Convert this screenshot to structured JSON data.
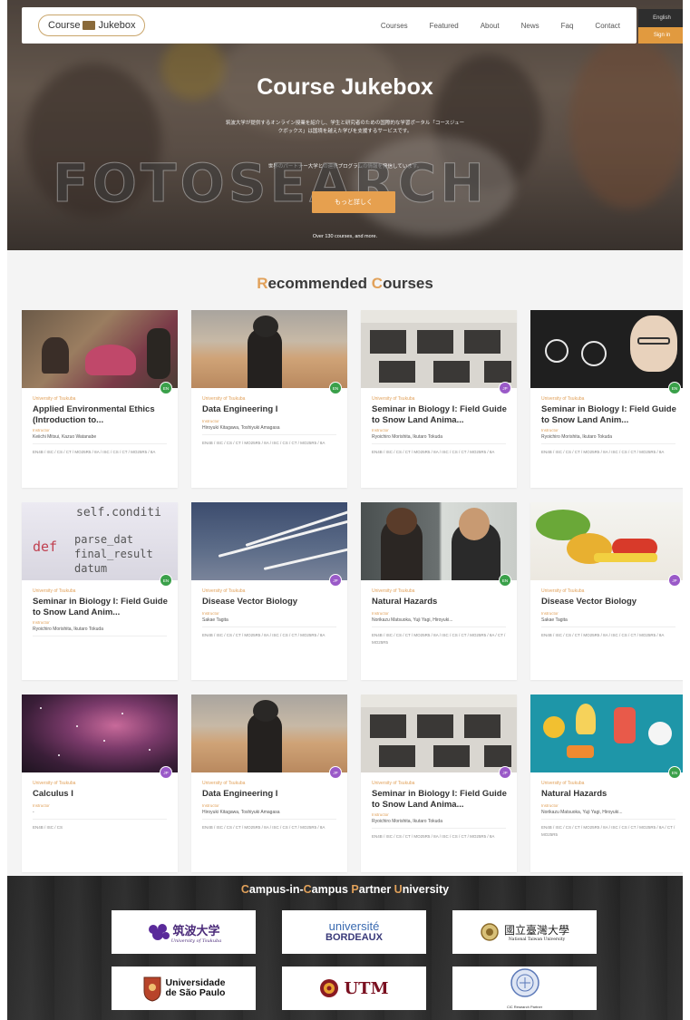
{
  "nav": {
    "logo_left": "Course",
    "logo_right": "Jukebox",
    "links": [
      "Courses",
      "Featured",
      "About",
      "News",
      "Faq",
      "Contact"
    ],
    "lang": "English",
    "signin": "Sign in"
  },
  "hero": {
    "title": "Course Jukebox",
    "desc1": "筑波大学が提供するオンライン授業を紹介し、学生と研究者のための国際的な学習ポータル「コースジュークボックス」は国境を越えた学びを支援するサービスです。",
    "desc2": "世界のパートナー大学との連携プログラムの情報を発信しています。",
    "cta": "もっと詳しく",
    "count": "Over 130 courses, and more."
  },
  "watermark": "FOTOSEARCH",
  "recommended": {
    "title_a1": "R",
    "title_a2": "ecommended ",
    "title_b1": "C",
    "title_b2": "ourses"
  },
  "courses": [
    {
      "univ": "University of Tsukuba",
      "title": "Applied Environmental Ethics (Introduction to...",
      "instr_label": "Instructor",
      "instr": "Keiichi Mitsui, Kazuo Watanabe",
      "tags": "EN4B / ISC / CS / CT / MO25R5 / 8A / ISC / CS / CT / MO25R5 / 8A",
      "badge": "EN"
    },
    {
      "univ": "University of Tsukuba",
      "title": "Data Engineering I",
      "instr_label": "Instructor",
      "instr": "Hiroyuki Kitagawa, Toshiyuki Amagasa",
      "tags": "EN4B / ISC / CS / CT / MO25R5 / 8A / ISC / CS / CT / MO25R5 / 8A",
      "badge": "EN"
    },
    {
      "univ": "University of Tsukuba",
      "title": "Seminar in Biology I: Field Guide to Snow Land Anima...",
      "instr_label": "Instructor",
      "instr": "Ryoichiro Morishita, Ikutaro Tokuda",
      "tags": "EN4B / ISC / CS / CT / MO25R5 / 8A / ISC / CS / CT / MO25R5 / 8A",
      "badge": "JP"
    },
    {
      "univ": "University of Tsukuba",
      "title": "Seminar in Biology I: Field Guide to Snow Land Anim...",
      "instr_label": "Instructor",
      "instr": "Ryoichiro Morishita, Ikutaro Tokuda",
      "tags": "EN4B / ISC / CS / CT / MO25R5 / 8A / ISC / CS / CT / MO25R5 / 8A",
      "badge": "EN"
    },
    {
      "univ": "University of Tsukuba",
      "title": "Seminar in Biology I: Field Guide to Snow Land Anim...",
      "instr_label": "Instructor",
      "instr": "Ryoichiro Morishita, Ikutaro Tokuda",
      "tags": "",
      "badge": "EN"
    },
    {
      "univ": "University of Tsukuba",
      "title": "Disease Vector Biology",
      "instr_label": "Instructor",
      "instr": "Sakae Tagita",
      "tags": "EN4B / ISC / CS / CT / MO25R5 / 8A / ISC / CS / CT / MO25R5 / 8A",
      "badge": "JP"
    },
    {
      "univ": "University of Tsukuba",
      "title": "Natural Hazards",
      "instr_label": "Instructor",
      "instr": "Norikazu Matsuoka, Yuji Yagi, Hiroyuki...",
      "tags": "EN4B / ISC / CS / CT / MO25R5 / 8A / ISC / CS / CT / MO25R5 / 8A / CT / MO25R5",
      "badge": "EN"
    },
    {
      "univ": "University of Tsukuba",
      "title": "Disease Vector Biology",
      "instr_label": "Instructor",
      "instr": "Sakae Tagita",
      "tags": "EN4B / ISC / CS / CT / MO25R5 / 8A / ISC / CS / CT / MO25R5 / 8A",
      "badge": "JP"
    },
    {
      "univ": "University of Tsukuba",
      "title": "Calculus I",
      "instr_label": "Instructor",
      "instr": "-",
      "tags": "EN4B / ISC / CS",
      "badge": "JP"
    },
    {
      "univ": "University of Tsukuba",
      "title": "Data Engineering I",
      "instr_label": "Instructor",
      "instr": "Hiroyuki Kitagawa, Toshiyuki Amagasa",
      "tags": "EN4B / ISC / CS / CT / MO25R5 / 8A / ISC / CS / CT / MO25R5 / 8A",
      "badge": "JP"
    },
    {
      "univ": "University of Tsukuba",
      "title": "Seminar in Biology I: Field Guide to Snow Land Anima...",
      "instr_label": "Instructor",
      "instr": "Ryoichiro Morishita, Ikutaro Tokuda",
      "tags": "EN4B / ISC / CS / CT / MO25R5 / 8A / ISC / CS / CT / MO25R5 / 8A",
      "badge": "JP"
    },
    {
      "univ": "University of Tsukuba",
      "title": "Natural Hazards",
      "instr_label": "Instructor",
      "instr": "Norikazu Matsuoka, Yuji Yagi, Hiroyuki...",
      "tags": "EN4B / ISC / CS / CT / MO25R5 / 8A / ISC / CS / CT / MO25R5 / 8A / CT / MO25R5",
      "badge": "EN"
    }
  ],
  "partners": {
    "title_parts": [
      "C",
      "ampus-in-",
      "C",
      "ampus ",
      "P",
      "artner ",
      "U",
      "niversity"
    ],
    "tsukuba": "筑波大学",
    "tsukuba_sub": "University of Tsukuba",
    "bordeaux_a": "université",
    "bordeaux_b": "BORDEAUX",
    "ntu": "國立臺灣大學",
    "ntu_sub": "National Taiwan University",
    "usp_a": "Universidade",
    "usp_b": "de São Paulo",
    "utm": "UTM",
    "last_sub": "CiC Research Partner"
  },
  "colors": {
    "accent": "#e1a15a",
    "badge_en": "#3aa04a",
    "badge_jp": "#9a5ac8"
  }
}
